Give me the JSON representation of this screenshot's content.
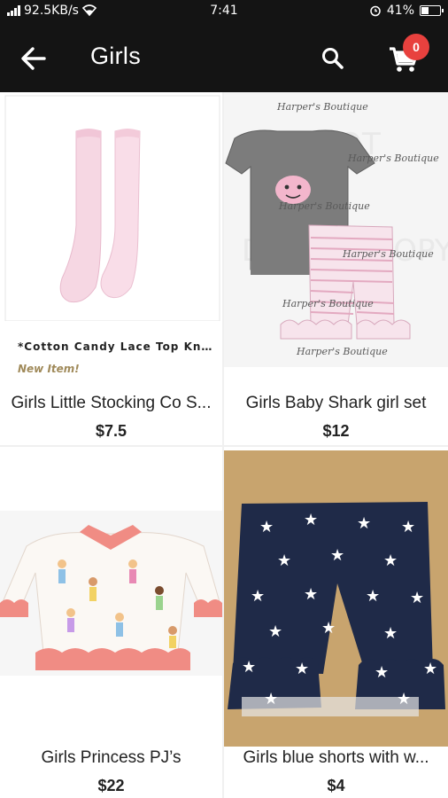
{
  "status_bar": {
    "speed": "92.5KB/s",
    "time": "7:41",
    "battery_text": "41%",
    "battery_level": 0.41
  },
  "header": {
    "title": "Girls",
    "cart_count": "0",
    "icons": {
      "back": "arrow-left-icon",
      "search": "search-icon",
      "cart": "cart-icon"
    }
  },
  "products": [
    {
      "name": "Girls Little Stocking Co S...",
      "price": "$7.5",
      "caption": "*Cotton Candy Lace Top Kn...",
      "tag": "New Item!"
    },
    {
      "name": "Girls Baby Shark girl set",
      "price": "$12",
      "watermark": "Harper's Boutique",
      "watermark2": "DO NOT COPY",
      "watermark3": "COPY"
    },
    {
      "name": "Girls Princess PJ’s",
      "price": "$22"
    },
    {
      "name": "Girls blue shorts with w...",
      "price": "$4"
    }
  ],
  "colors": {
    "bar": "#141414",
    "badge": "#e8413e",
    "text": "#222222"
  }
}
